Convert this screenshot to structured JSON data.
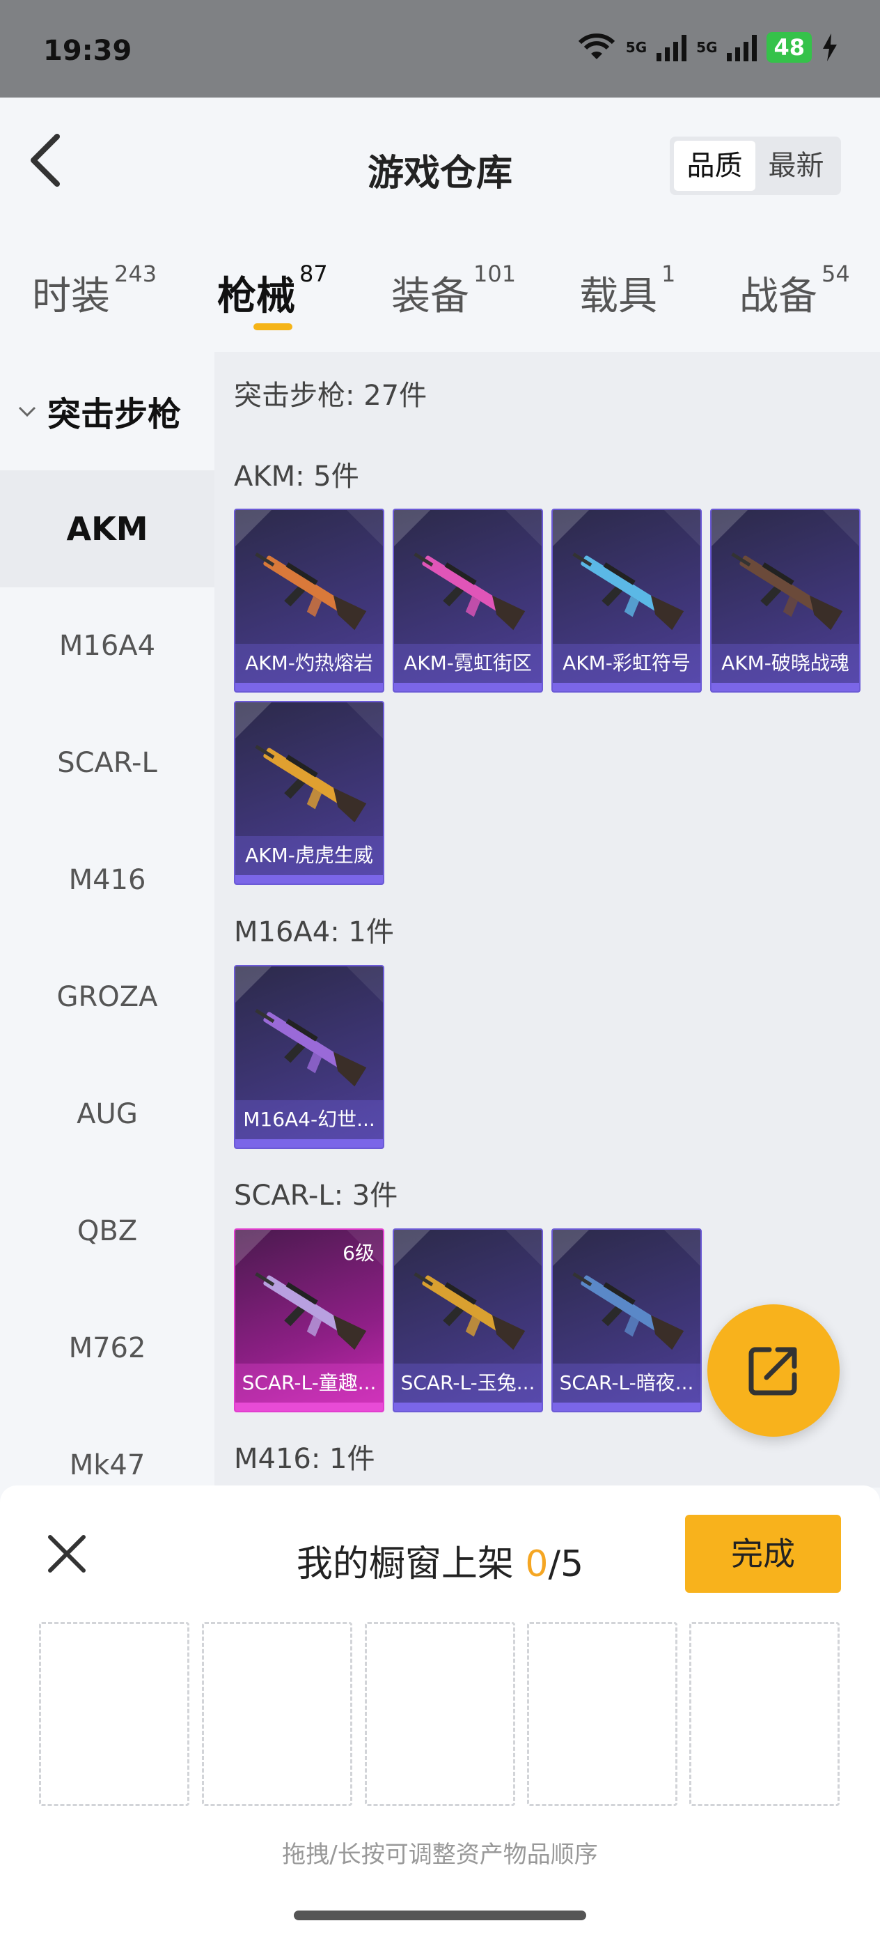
{
  "status_bar": {
    "time": "19:39",
    "net1": "5G",
    "net2": "5G",
    "battery": "48"
  },
  "header": {
    "title": "游戏仓库",
    "sort_options": [
      "品质",
      "最新"
    ],
    "sort_active": "品质"
  },
  "tabs": [
    {
      "label": "时装",
      "count": "243"
    },
    {
      "label": "枪械",
      "count": "87"
    },
    {
      "label": "装备",
      "count": "101"
    },
    {
      "label": "载具",
      "count": "1"
    },
    {
      "label": "战备",
      "count": "54"
    }
  ],
  "active_tab": "枪械",
  "sidebar": {
    "group": "突击步枪",
    "items": [
      "AKM",
      "M16A4",
      "SCAR-L",
      "M416",
      "GROZA",
      "AUG",
      "QBZ",
      "M762",
      "Mk47"
    ],
    "active": "AKM"
  },
  "main": {
    "summary": "突击步枪: 27件",
    "sections": [
      {
        "title": "AKM: 5件",
        "items": [
          {
            "name": "AKM-灼热熔岩",
            "gun_color": "#d9793a"
          },
          {
            "name": "AKM-霓虹街区",
            "gun_color": "#e055b8"
          },
          {
            "name": "AKM-彩虹符号",
            "gun_color": "#5bb8e6"
          },
          {
            "name": "AKM-破晓战魂",
            "gun_color": "#6b4a3a"
          },
          {
            "name": "AKM-虎虎生威",
            "gun_color": "#e0a030"
          }
        ]
      },
      {
        "title": "M16A4: 1件",
        "items": [
          {
            "name": "M16A4-幻世...",
            "gun_color": "#9a6ad8"
          }
        ]
      },
      {
        "title": "SCAR-L: 3件",
        "items": [
          {
            "name": "SCAR-L-童趣...",
            "gun_color": "#b8a0e0",
            "level": "6级",
            "rarity": "pink"
          },
          {
            "name": "SCAR-L-玉兔...",
            "gun_color": "#d9a030"
          },
          {
            "name": "SCAR-L-暗夜...",
            "gun_color": "#5a88c8"
          }
        ]
      },
      {
        "title": "M416: 1件",
        "items": []
      }
    ]
  },
  "sheet": {
    "title_prefix": "我的橱窗上架 ",
    "count_current": "0",
    "count_total": "/5",
    "done_label": "完成",
    "hint": "拖拽/长按可调整资产物品顺序"
  },
  "colors": {
    "accent": "#f8b21c",
    "card_border": "#6b5ad6",
    "card_pink": "#e23dcf"
  }
}
